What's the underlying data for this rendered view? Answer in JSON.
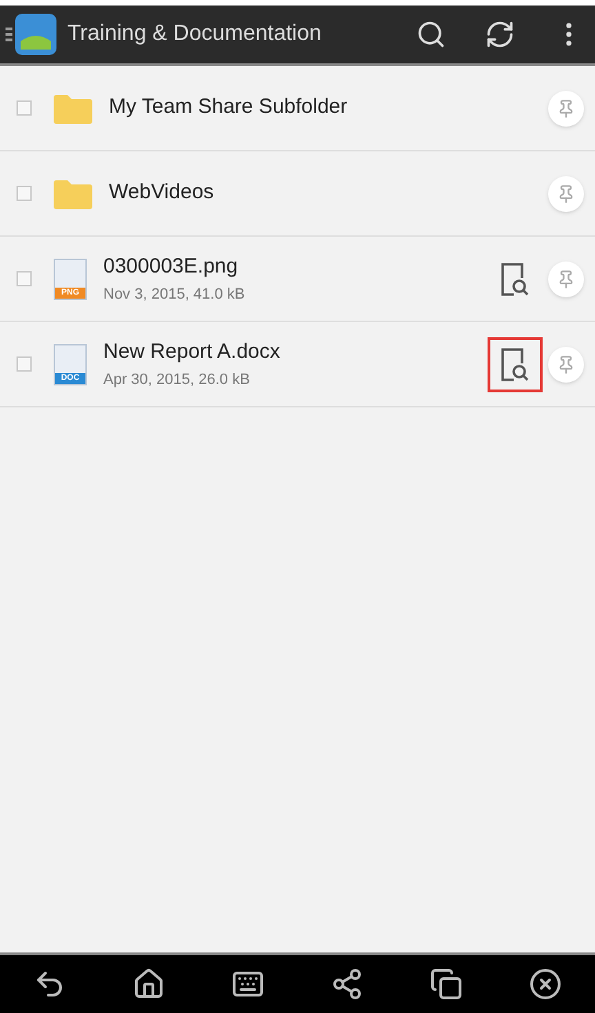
{
  "app_bar": {
    "title": "Training & Documentation"
  },
  "items": [
    {
      "kind": "folder",
      "name": "My Team Share Subfolder",
      "checked": false
    },
    {
      "kind": "folder",
      "name": "WebVideos",
      "checked": false
    },
    {
      "kind": "file",
      "name": "0300003E.png",
      "details": "Nov 3, 2015, 41.0 kB",
      "badge": "PNG",
      "color": "#f08a24",
      "checked": false,
      "preview_highlighted": false
    },
    {
      "kind": "file",
      "name": "New Report A.docx",
      "details": "Apr 30, 2015, 26.0 kB",
      "badge": "DOC",
      "color": "#2a8ad4",
      "checked": false,
      "preview_highlighted": true
    }
  ]
}
